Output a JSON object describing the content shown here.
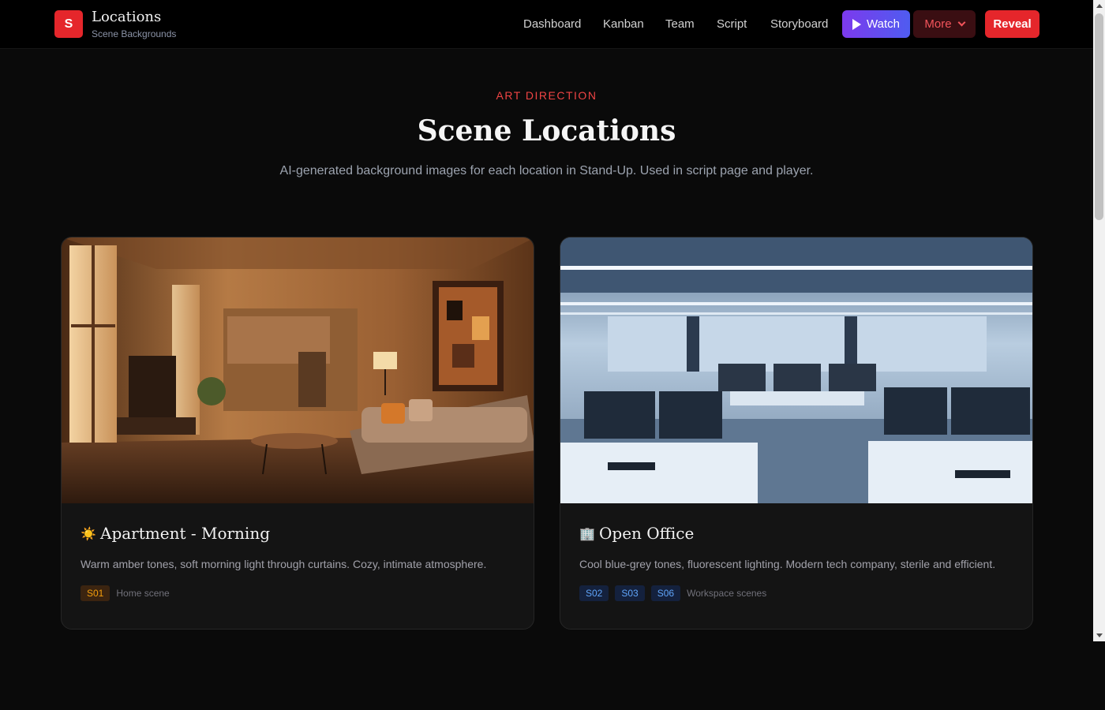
{
  "brand": {
    "logo_letter": "S",
    "title": "Locations",
    "subtitle": "Scene Backgrounds"
  },
  "nav": {
    "links": [
      "Dashboard",
      "Kanban",
      "Team",
      "Script",
      "Storyboard"
    ],
    "watch_label": "Watch",
    "more_label": "More",
    "reveal_label": "Reveal"
  },
  "header": {
    "eyebrow": "ART DIRECTION",
    "title": "Scene Locations",
    "description": "AI-generated background images for each location in Stand-Up. Used in script page and player."
  },
  "locations": [
    {
      "icon": "☀️",
      "icon_name": "sun-icon",
      "title": "Apartment - Morning",
      "description": "Warm amber tones, soft morning light through curtains. Cozy, intimate atmosphere.",
      "tags": [
        "S01"
      ],
      "tag_color": "#f59e0b",
      "note": "Home scene"
    },
    {
      "icon": "🏢",
      "icon_name": "office-building-icon",
      "title": "Open Office",
      "description": "Cool blue-grey tones, fluorescent lighting. Modern tech company, sterile and efficient.",
      "tags": [
        "S02",
        "S03",
        "S06"
      ],
      "tag_color": "#60a5fa",
      "note": "Workspace scenes"
    }
  ],
  "colors": {
    "accent": "#e5262b",
    "watch_gradient_start": "#7c3aed",
    "watch_gradient_end": "#4f5cf0"
  }
}
